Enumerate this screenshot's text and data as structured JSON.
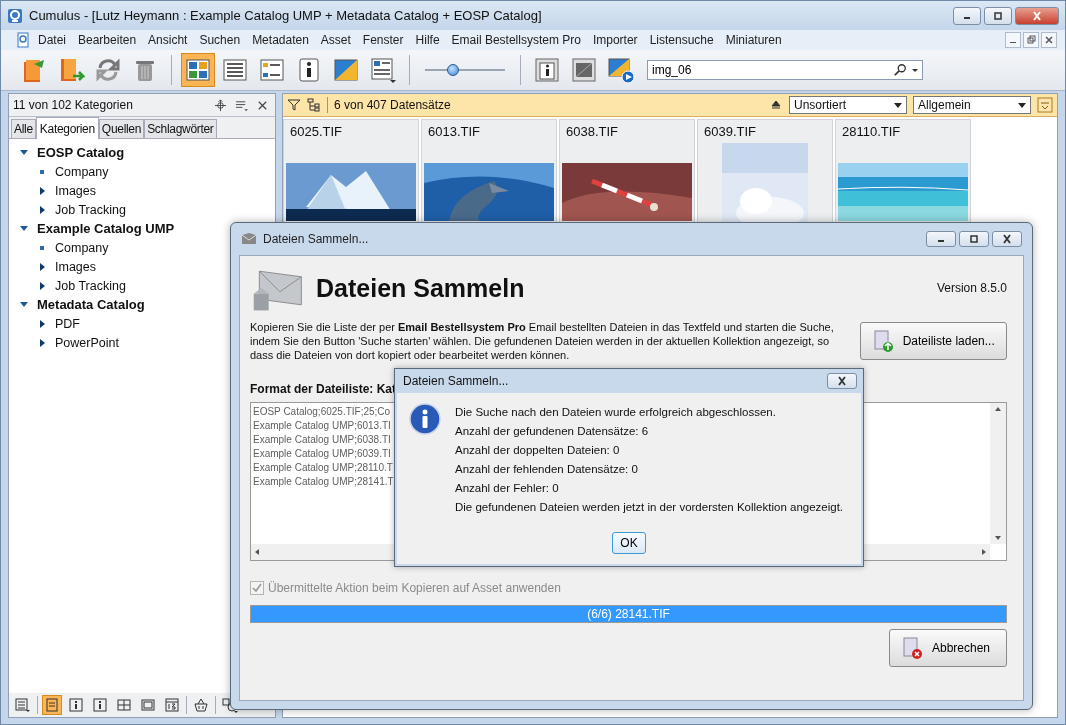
{
  "window": {
    "title": "Cumulus - [Lutz Heymann : Example Catalog UMP + Metadata Catalog + EOSP Catalog]"
  },
  "menu": [
    "Datei",
    "Bearbeiten",
    "Ansicht",
    "Suchen",
    "Metadaten",
    "Asset",
    "Fenster",
    "Hilfe",
    "Email Bestellsystem Pro",
    "Importer",
    "Listensuche",
    "Miniaturen"
  ],
  "toolbar": {
    "buttons": [
      {
        "selected": false
      },
      {
        "selected": false
      },
      {
        "selected": false
      },
      {
        "selected": false
      },
      {
        "selected": true
      },
      {
        "selected": false
      },
      {
        "selected": false
      },
      {
        "selected": false
      },
      {
        "selected": false
      },
      {
        "selected": false
      },
      {
        "selected": false
      },
      {
        "selected": false
      },
      {
        "selected": false
      }
    ],
    "zoom_slider": {
      "level": 0.35
    },
    "search": {
      "value": "img_06"
    }
  },
  "sidebar": {
    "header": "11 von 102 Kategorien",
    "tabs": [
      {
        "label": "Alle",
        "selected": false
      },
      {
        "label": "Kategorien",
        "selected": true
      },
      {
        "label": "Quellen",
        "selected": false
      },
      {
        "label": "Schlagwörter",
        "selected": false
      }
    ],
    "tree": [
      {
        "label": "EOSP Catalog",
        "expanded": true,
        "children": [
          {
            "label": "Company",
            "kind": "leaf"
          },
          {
            "label": "Images",
            "kind": "branch",
            "expanded": false
          },
          {
            "label": "Job Tracking",
            "kind": "branch",
            "expanded": false
          }
        ]
      },
      {
        "label": "Example Catalog UMP",
        "expanded": true,
        "children": [
          {
            "label": "Company",
            "kind": "leaf"
          },
          {
            "label": "Images",
            "kind": "branch",
            "expanded": false
          },
          {
            "label": "Job Tracking",
            "kind": "branch",
            "expanded": false
          }
        ]
      },
      {
        "label": "Metadata Catalog",
        "expanded": true,
        "children": [
          {
            "label": "PDF",
            "kind": "branch",
            "expanded": false
          },
          {
            "label": "PowerPoint",
            "kind": "branch",
            "expanded": false
          }
        ]
      }
    ],
    "bottom_tools": [
      {
        "selected": false
      },
      {
        "selected": true
      },
      {
        "selected": false
      },
      {
        "selected": false
      },
      {
        "selected": false
      },
      {
        "selected": false
      },
      {
        "selected": false
      },
      {
        "selected": false
      },
      {
        "selected": false
      }
    ]
  },
  "collection": {
    "count": "6 von 407 Datensätze",
    "sort": "Unsortiert",
    "view": "Allgemein",
    "thumbnails": [
      {
        "name": "6025.TIF"
      },
      {
        "name": "6013.TIF"
      },
      {
        "name": "6038.TIF"
      },
      {
        "name": "6039.TIF"
      },
      {
        "name": "28110.TIF"
      }
    ]
  },
  "dialog": {
    "title": "Dateien Sammeln...",
    "heading": "Dateien Sammeln",
    "version": "Version 8.5.0",
    "description": "Kopieren Sie die Liste der per **Email Bestellsystem Pro** Email bestellten Dateien in das Textfeld und starten die Suche, indem Sie den Button 'Suche starten' wählen. Die gefundenen Dateien werden in der aktuellen Kollektion angezeigt, so dass die Dateien von dort kopiert oder bearbeitet werden können.",
    "load_button": "Dateiliste laden...",
    "format_label": "Format der Dateiliste: Kat",
    "file_list": [
      "EOSP Catalog;6025.TIF;25;Co",
      "Example Catalog UMP;6013.TI",
      "Example Catalog UMP;6038.TI",
      "Example Catalog UMP;6039.TI",
      "Example Catalog UMP;28110.T",
      "Example Catalog UMP;28141.T"
    ],
    "apply_action": {
      "label": "Übermittelte Aktion beim Kopieren auf Asset anwenden",
      "checked": true,
      "disabled": true
    },
    "progress": {
      "label": "(6/6) 28141.TIF",
      "level": 1
    },
    "cancel_button": "Abbrechen"
  },
  "message_box": {
    "title": "Dateien Sammeln...",
    "lines": [
      "Die Suche nach den Dateien wurde erfolgreich abgeschlossen.",
      "Anzahl der gefundenen Datensätze: 6",
      "Anzahl der doppelten Dateien: 0",
      "Anzahl der fehlenden Datensätze: 0",
      "Anzahl der Fehler: 0",
      "Die gefundenen Dateien werden jetzt in der vordersten Kollektion angezeigt."
    ],
    "ok_button": "OK"
  }
}
